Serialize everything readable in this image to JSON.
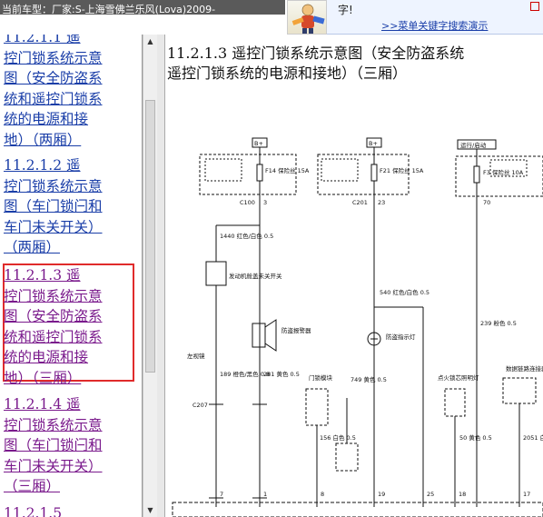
{
  "topbar": {
    "current_model": "当前车型：厂家:S-上海雪佛兰乐风(Lova)2009-",
    "promo_text": "字!",
    "promo_link": ">>菜单关键字搜索演示"
  },
  "sidebar": {
    "items": [
      {
        "text": "11.2.1.1 遥控门锁系统示意图（安全防盗系统和遥控门锁系统的电源和接地）（两厢）",
        "visible": "11.2.1.1 遥\n控门锁系统示意\n图（安全防盗系\n统和遥控门锁系\n统的电源和接\n地）（两厢）"
      },
      {
        "text": "11.2.1.2 遥控门锁系统示意图（车门锁闩和车门未关开关）（两厢）",
        "visible": "11.2.1.2 遥\n控门锁系统示意\n图（车门锁闩和\n车门未关开关）\n（两厢）"
      },
      {
        "text": "11.2.1.3 遥控门锁系统示意图（安全防盗系统和遥控门锁系统的电源和接地）（三厢）",
        "visible": "11.2.1.3 遥\n控门锁系统示意\n图（安全防盗系\n统和遥控门锁系\n统的电源和接\n地）（三厢）"
      },
      {
        "text": "11.2.1.4 遥控门锁系统示意图（车门锁闩和车门未关开关）（三厢）",
        "visible": "11.2.1.4 遥\n控门锁系统示意\n图（车门锁闩和\n车门未关开关）\n（三厢）"
      },
      {
        "text": "11.2.1.5",
        "visible": "11.2.1.5"
      }
    ]
  },
  "main": {
    "title_line1": "11.2.1.3 遥控门锁系统示意图（安全防盗系统",
    "title_line2": "遥控门锁系统的电源和接地）（三厢）"
  },
  "diagram": {
    "bplus": "B+",
    "run_start": "运行/启动",
    "fuse_block_note": "\"熔断器盒\"中的\"配电示意图\"",
    "fuse_block_note_short": "\"保险丝盒\"中的\"电源示意图\"",
    "engine_fuse_box": "发动机舱保险丝盒",
    "dash_fuse_box": "仪表板保险丝盒",
    "f14": "F14 保险丝 15A",
    "f21": "F21 保险丝 15A",
    "f3": "F3 保险丝 10A",
    "c100": "C100",
    "c201": "C201",
    "c207": "C207",
    "pin_3": "3",
    "pin_23": "23",
    "pin_70": "70",
    "pin_1": "1",
    "pin_4": "4",
    "pin_7": "7",
    "pin_8": "8",
    "pin_19": "19",
    "pin_25": "25",
    "pin_18": "18",
    "pin_17": "17",
    "w1440": "1440 红色/白色 0.5",
    "w540": "540 红色/白色 0.5",
    "w239": "239 粉色 0.5",
    "w189": "189 橙色/黑色 0.8",
    "w281": "281 黄色 0.5",
    "w749": "749 黄色 0.5",
    "w156": "156 白色 0.5",
    "w50": "50 黄色 0.5",
    "w2051": "2051 白色/黑色 0.5",
    "hood_switch": "发动机舱盖未关开关",
    "siren": "防盗报警器",
    "door_lock_note": "\"车门\"中的\"门锁/防盗示意图\"",
    "horn_note": "\"喇叭\"中的\"喇叭示意图\"",
    "security_led": "防盗指示灯",
    "left_module": "左视镜",
    "door_lock_module": "门锁模块",
    "ignition_switch": "点火锁芯照明灯",
    "dlc": "数据链路连接器(DLC)",
    "immobilizer": "防盗控制模块",
    "bottom_labels": [
      "发动机舱盖未关开关信号",
      "后视镜控制信号",
      "车门",
      "安全系统指示灯控制",
      "喇叭继电器",
      "点火钥匙未拔出开关",
      "串行数据",
      "串行数据"
    ]
  }
}
